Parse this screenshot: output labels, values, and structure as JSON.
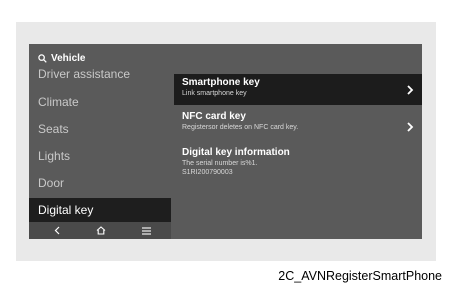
{
  "search": {
    "label": "Vehicle",
    "icon": "search-icon"
  },
  "sidebar": {
    "items": [
      {
        "label": "Driver assistance"
      },
      {
        "label": "Climate"
      },
      {
        "label": "Seats"
      },
      {
        "label": "Lights"
      },
      {
        "label": "Door"
      },
      {
        "label": "Digital key",
        "active": true
      }
    ]
  },
  "bottom_bar": {
    "icons": [
      "back-icon",
      "home-icon",
      "menu-icon"
    ]
  },
  "content": {
    "rows": [
      {
        "title": "Smartphone key",
        "subtitle": "Link smartphone key",
        "selected": true,
        "chevron": true
      },
      {
        "title": "NFC card key",
        "subtitle": "Registersor deletes on NFC card key.",
        "selected": false,
        "chevron": true
      },
      {
        "title": "Digital key information",
        "subtitle_lines": [
          "The serial number is%1.",
          "S1RI200790003"
        ],
        "selected": false,
        "chevron": false
      }
    ]
  },
  "caption": "2C_AVNRegisterSmartPhone",
  "colors": {
    "screen_bg": "#5a5a5a",
    "selected_bg": "#1c1c1c",
    "panel_bg": "#e9e9e9",
    "text_primary": "#ffffff",
    "text_muted": "#c9c9c9"
  }
}
